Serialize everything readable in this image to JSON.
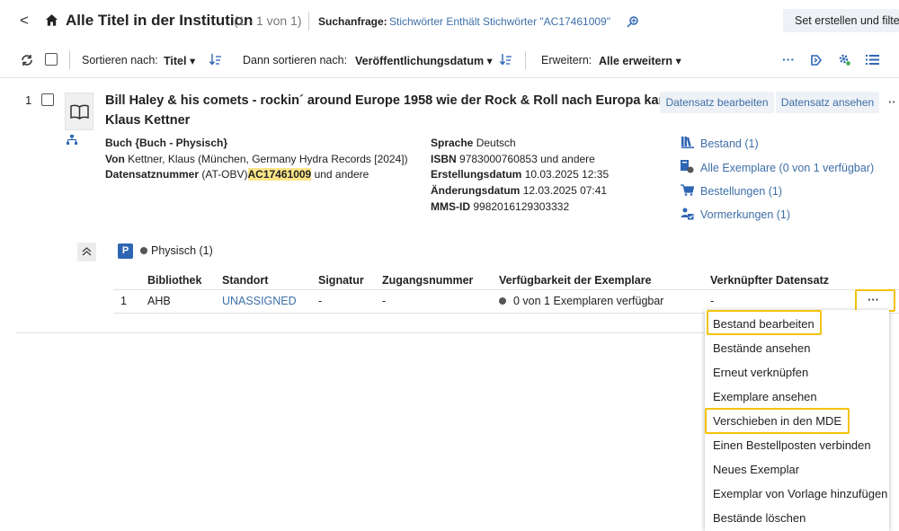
{
  "header": {
    "back_glyph": "<",
    "title": "Alle Titel in der Institution",
    "count": "(1 - 1 von 1)",
    "query_label": "Suchanfrage:",
    "query_value": "Stichwörter Enthält Stichwörter \"AC17461009\"",
    "create_set_button": "Set erstellen und filte"
  },
  "toolbar": {
    "sort_label": "Sortieren nach:",
    "sort_value": "Titel",
    "then_sort_label": "Dann sortieren nach:",
    "then_sort_value": "Veröffentlichungsdatum",
    "expand_label": "Erweitern:",
    "expand_value": "Alle erweitern",
    "more": "···"
  },
  "record": {
    "index": "1",
    "title_line1": "Bill Haley & his comets - rockin´ around Europe 1958 wie der Rock & Roll nach Europa kam",
    "title_line2": "Klaus Kettner",
    "type_line": "Buch {Buch - Physisch}",
    "by_label": "Von",
    "by_value": "Kettner, Klaus (München, Germany Hydra Records [2024])",
    "record_no_label": "Datensatznummer",
    "record_no_prefix": "(AT-OBV)",
    "record_no_value": "AC17461009",
    "record_no_suffix": "und andere",
    "language_label": "Sprache",
    "language_value": "Deutsch",
    "isbn_label": "ISBN",
    "isbn_value": "9783000760853 und andere",
    "created_label": "Erstellungsdatum",
    "created_value": "10.03.2025 12:35",
    "modified_label": "Änderungsdatum",
    "modified_value": "12.03.2025 07:41",
    "mms_label": "MMS-ID",
    "mms_value": "9982016129303332",
    "edit_button": "Datensatz bearbeiten",
    "view_button": "Datensatz ansehen",
    "more": "··",
    "links": {
      "holdings": "Bestand (1)",
      "all_items": "Alle Exemplare (0 von 1 verfügbar)",
      "orders": "Bestellungen (1)",
      "requests": "Vormerkungen (1)"
    }
  },
  "physical": {
    "badge": "P",
    "label": "Physisch (1)"
  },
  "holdings_table": {
    "headers": [
      "",
      "Bibliothek",
      "Standort",
      "Signatur",
      "Zugangsnummer",
      "Verfügbarkeit der Exemplare",
      "Verknüpfter Datensatz"
    ],
    "row": {
      "index": "1",
      "library": "AHB",
      "location": "UNASSIGNED",
      "call_number": "-",
      "accession": "-",
      "availability": "0 von 1 Exemplaren verfügbar",
      "linked": "-",
      "actions": "···"
    }
  },
  "menu": {
    "items": [
      "Bestand bearbeiten",
      "Bestände ansehen",
      "Erneut verknüpfen",
      "Exemplare ansehen",
      "Verschieben in den MDE",
      "Einen Bestellposten verbinden",
      "Neues Exemplar",
      "Exemplar von Vorlage hinzufügen",
      "Bestände löschen"
    ]
  },
  "colors": {
    "link": "#3e6fa8",
    "highlight_border": "#f4c20d",
    "highlight_fill": "#fde68a",
    "badge": "#2f66b3",
    "status_dot": "#555555"
  }
}
